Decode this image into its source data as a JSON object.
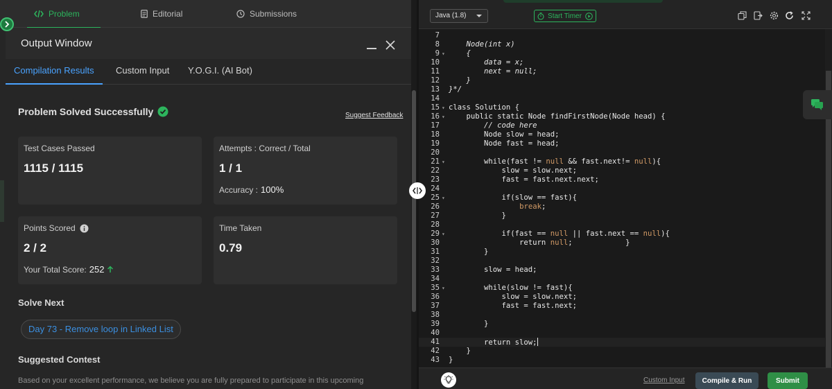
{
  "nav": {
    "tabs": [
      {
        "label": "Problem",
        "icon": "code-icon",
        "active": true
      },
      {
        "label": "Editorial",
        "icon": "document-icon",
        "active": false
      },
      {
        "label": "Submissions",
        "icon": "clock-icon",
        "active": false
      }
    ]
  },
  "output": {
    "title": "Output Window",
    "tabs": [
      {
        "label": "Compilation Results",
        "active": true
      },
      {
        "label": "Custom Input",
        "active": false
      },
      {
        "label": "Y.O.G.I. (AI Bot)",
        "active": false
      }
    ],
    "status": "Problem Solved Successfully",
    "feedback_link": "Suggest Feedback",
    "cards": {
      "test_cases": {
        "label": "Test Cases Passed",
        "value": "1115 / 1115"
      },
      "attempts": {
        "label": "Attempts : Correct / Total",
        "value": "1 / 1",
        "accuracy_label": "Accuracy :",
        "accuracy_value": "100%"
      },
      "points": {
        "label": "Points Scored",
        "value": "2 / 2",
        "total_label": "Your Total Score:",
        "total_value": "252"
      },
      "time": {
        "label": "Time Taken",
        "value": "0.79"
      }
    },
    "solve_next_heading": "Solve Next",
    "solve_next_item": "Day 73 - Remove loop in Linked List",
    "suggested_contest_heading": "Suggested Contest",
    "suggested_contest_text": "Based on your excellent performance, we believe you are fully prepared to participate in this upcoming"
  },
  "editor": {
    "language": "Java (1.8)",
    "timer_label": "Start Timer",
    "lines": [
      {
        "n": "7",
        "t": ""
      },
      {
        "n": "8",
        "t": "    Node(int x)",
        "c": "cmt"
      },
      {
        "n": "9",
        "t": "    {",
        "c": "cmt",
        "fold": true
      },
      {
        "n": "10",
        "t": "        data = x;",
        "c": "cmt"
      },
      {
        "n": "11",
        "t": "        next = null;",
        "c": "cmt"
      },
      {
        "n": "12",
        "t": "    }",
        "c": "cmt"
      },
      {
        "n": "13",
        "t": "}*/",
        "c": "cmt"
      },
      {
        "n": "14",
        "t": ""
      },
      {
        "n": "15",
        "t": "class Solution {",
        "fold": true
      },
      {
        "n": "16",
        "t": "    public static Node findFirstNode(Node head) {",
        "fold": true
      },
      {
        "n": "17",
        "t": "        // code here",
        "c": "cmt"
      },
      {
        "n": "18",
        "t": "        Node slow = head;"
      },
      {
        "n": "19",
        "t": "        Node fast = head;"
      },
      {
        "n": "20",
        "t": ""
      },
      {
        "n": "21",
        "t": "        while(fast != null && fast.next!= null){",
        "fold": true
      },
      {
        "n": "22",
        "t": "            slow = slow.next;"
      },
      {
        "n": "23",
        "t": "            fast = fast.next.next;"
      },
      {
        "n": "24",
        "t": ""
      },
      {
        "n": "25",
        "t": "            if(slow == fast){",
        "fold": true
      },
      {
        "n": "26",
        "t": "                break;"
      },
      {
        "n": "27",
        "t": "            }"
      },
      {
        "n": "28",
        "t": ""
      },
      {
        "n": "29",
        "t": "            if(fast == null || fast.next == null){",
        "fold": true
      },
      {
        "n": "30",
        "t": "                return null;            }"
      },
      {
        "n": "31",
        "t": "        }"
      },
      {
        "n": "32",
        "t": ""
      },
      {
        "n": "33",
        "t": "        slow = head;"
      },
      {
        "n": "34",
        "t": ""
      },
      {
        "n": "35",
        "t": "        while(slow != fast){",
        "fold": true
      },
      {
        "n": "36",
        "t": "            slow = slow.next;"
      },
      {
        "n": "37",
        "t": "            fast = fast.next;"
      },
      {
        "n": "38",
        "t": ""
      },
      {
        "n": "39",
        "t": "        }"
      },
      {
        "n": "40",
        "t": ""
      },
      {
        "n": "41",
        "t": "        return slow;",
        "current": true
      },
      {
        "n": "42",
        "t": "    }"
      },
      {
        "n": "43",
        "t": "}"
      }
    ]
  },
  "footer": {
    "custom_input": "Custom Input",
    "compile_run": "Compile & Run",
    "submit": "Submit"
  },
  "colors": {
    "accent_green": "#2db55d",
    "accent_blue": "#4aa3ff",
    "link_blue": "#3b8fe0"
  }
}
